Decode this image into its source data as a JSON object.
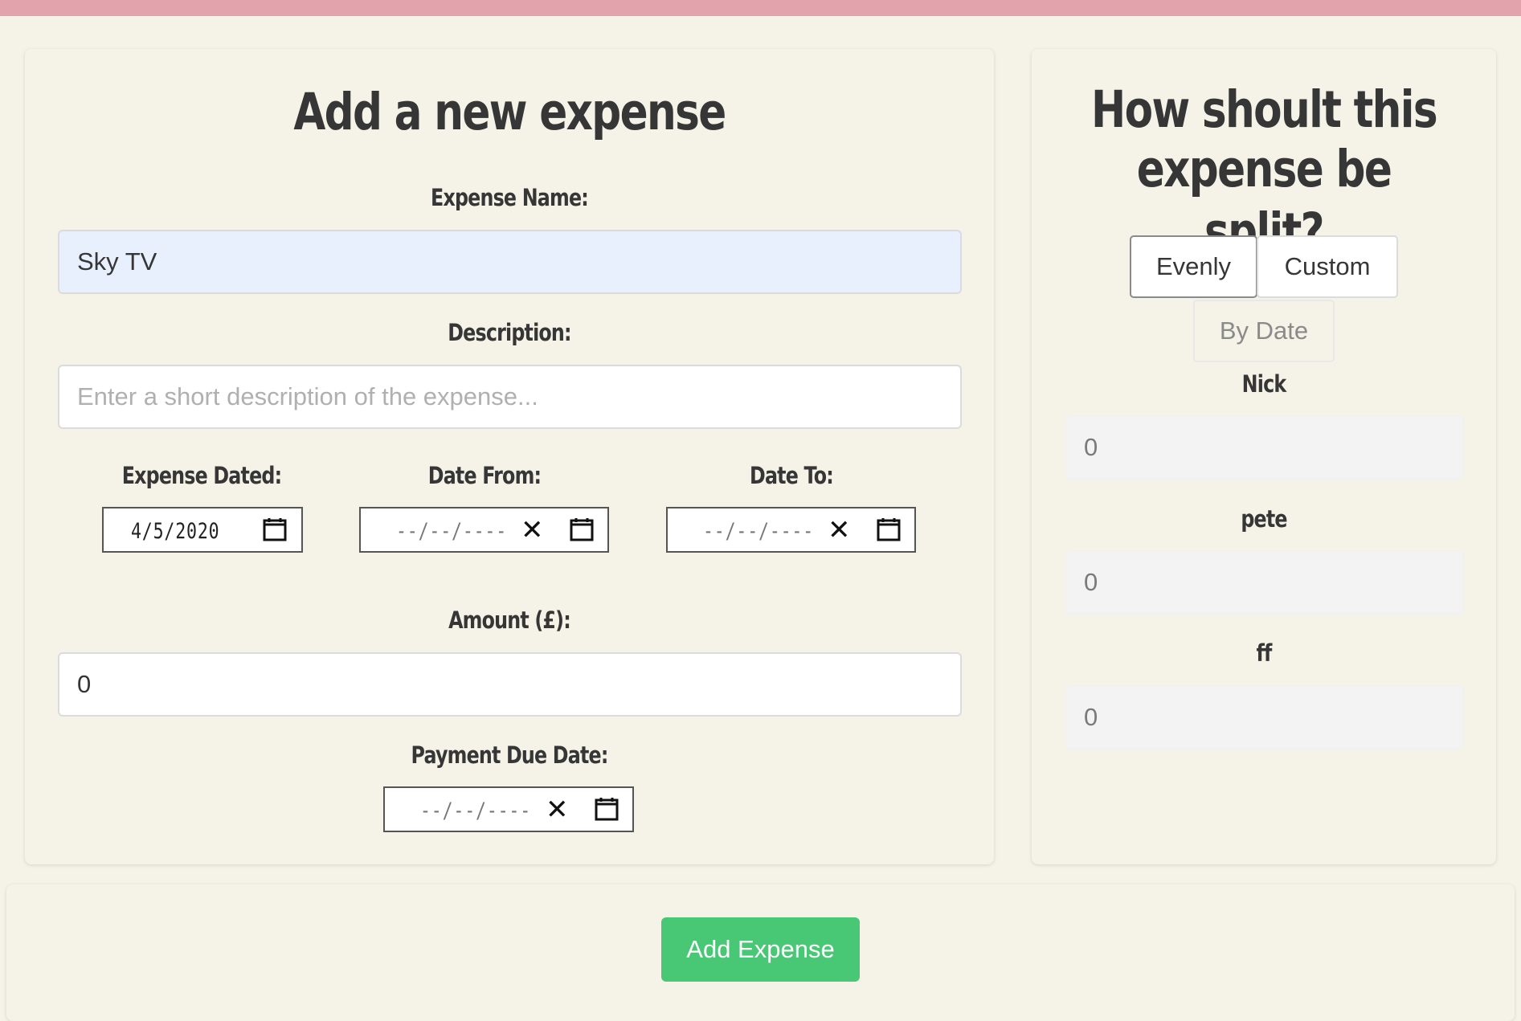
{
  "form": {
    "title": "Add a new expense",
    "name_label": "Expense Name:",
    "name_value": "Sky TV",
    "description_label": "Description:",
    "description_placeholder": "Enter a short description of the expense...",
    "dated_label": "Expense Dated:",
    "dated_value": "4/5/2020",
    "date_from_label": "Date From:",
    "date_from_value": "--/--/----",
    "date_to_label": "Date To:",
    "date_to_value": "--/--/----",
    "amount_label": "Amount (£):",
    "amount_value": "0",
    "due_label": "Payment Due Date:",
    "due_value": "--/--/----",
    "clear_glyph": "✕"
  },
  "split": {
    "title_line1": "How shoult this",
    "title_line2": "expense be split?",
    "options": {
      "evenly": "Evenly",
      "custom": "Custom",
      "by_date": "By Date"
    },
    "selected": "Evenly",
    "people": [
      {
        "name": "Nick",
        "value": "0"
      },
      {
        "name": "pete",
        "value": "0"
      },
      {
        "name": "ff",
        "value": "0"
      }
    ]
  },
  "actions": {
    "add_label": "Add Expense"
  },
  "colors": {
    "top_bar": "#e2a3ad",
    "background": "#f5f3e8",
    "primary_button": "#48c774",
    "autofill_input": "#e8f0fe"
  },
  "icons": {
    "calendar": "calendar-icon",
    "clear": "clear-icon"
  }
}
